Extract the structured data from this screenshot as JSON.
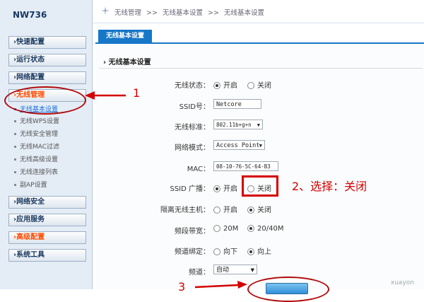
{
  "brand": "NW736",
  "menu": {
    "items": [
      {
        "label": "›快速配置"
      },
      {
        "label": "›运行状态"
      },
      {
        "label": "›网络配置"
      },
      {
        "label": "›无线管理"
      },
      {
        "label": "›网络安全"
      },
      {
        "label": "›应用服务"
      },
      {
        "label": "›高级配置"
      },
      {
        "label": "›系统工具"
      }
    ],
    "sub_items": [
      {
        "label": "无线基本设置"
      },
      {
        "label": "无线WPS设置"
      },
      {
        "label": "无线安全管理"
      },
      {
        "label": "无线MAC过滤"
      },
      {
        "label": "无线高级设置"
      },
      {
        "label": "无线连接列表"
      },
      {
        "label": "副AP设置"
      }
    ]
  },
  "breadcrumb": [
    "无线管理",
    ">>",
    "无线基本设置",
    ">>",
    "无线基本设置"
  ],
  "tab": {
    "label": "无线基本设置"
  },
  "section": {
    "title": "无线基本设置"
  },
  "form": {
    "wireless_status": {
      "label": "无线状态：",
      "on": "开启",
      "off": "关闭"
    },
    "ssid": {
      "label": "SSID号：",
      "value": "Netcore"
    },
    "standard": {
      "label": "无线标准：",
      "value": "802.11b+g+n"
    },
    "mode": {
      "label": "网络模式：",
      "value": "Access Point"
    },
    "mac": {
      "label": "MAC：",
      "value": "08-10-76-5C-64-B3"
    },
    "broadcast": {
      "label": "SSID 广播：",
      "on": "开启",
      "off": "关闭"
    },
    "isolate": {
      "label": "隔离无线主机：",
      "on": "开启",
      "off": "关闭"
    },
    "bandwidth": {
      "label": "频段带宽：",
      "opt1": "20M",
      "opt2": "20/40M"
    },
    "channel_bind": {
      "label": "频道绑定：",
      "opt1": "向下",
      "opt2": "向上"
    },
    "channel": {
      "label": "频道：",
      "value": "自动"
    }
  },
  "annotations": {
    "one": "1",
    "two": "2、选择：关闭",
    "three": "3"
  },
  "watermark": "xuayon",
  "colors": {
    "accent": "#1677c8",
    "annotation": "#d40000",
    "active_menu": "#ff4b00"
  }
}
